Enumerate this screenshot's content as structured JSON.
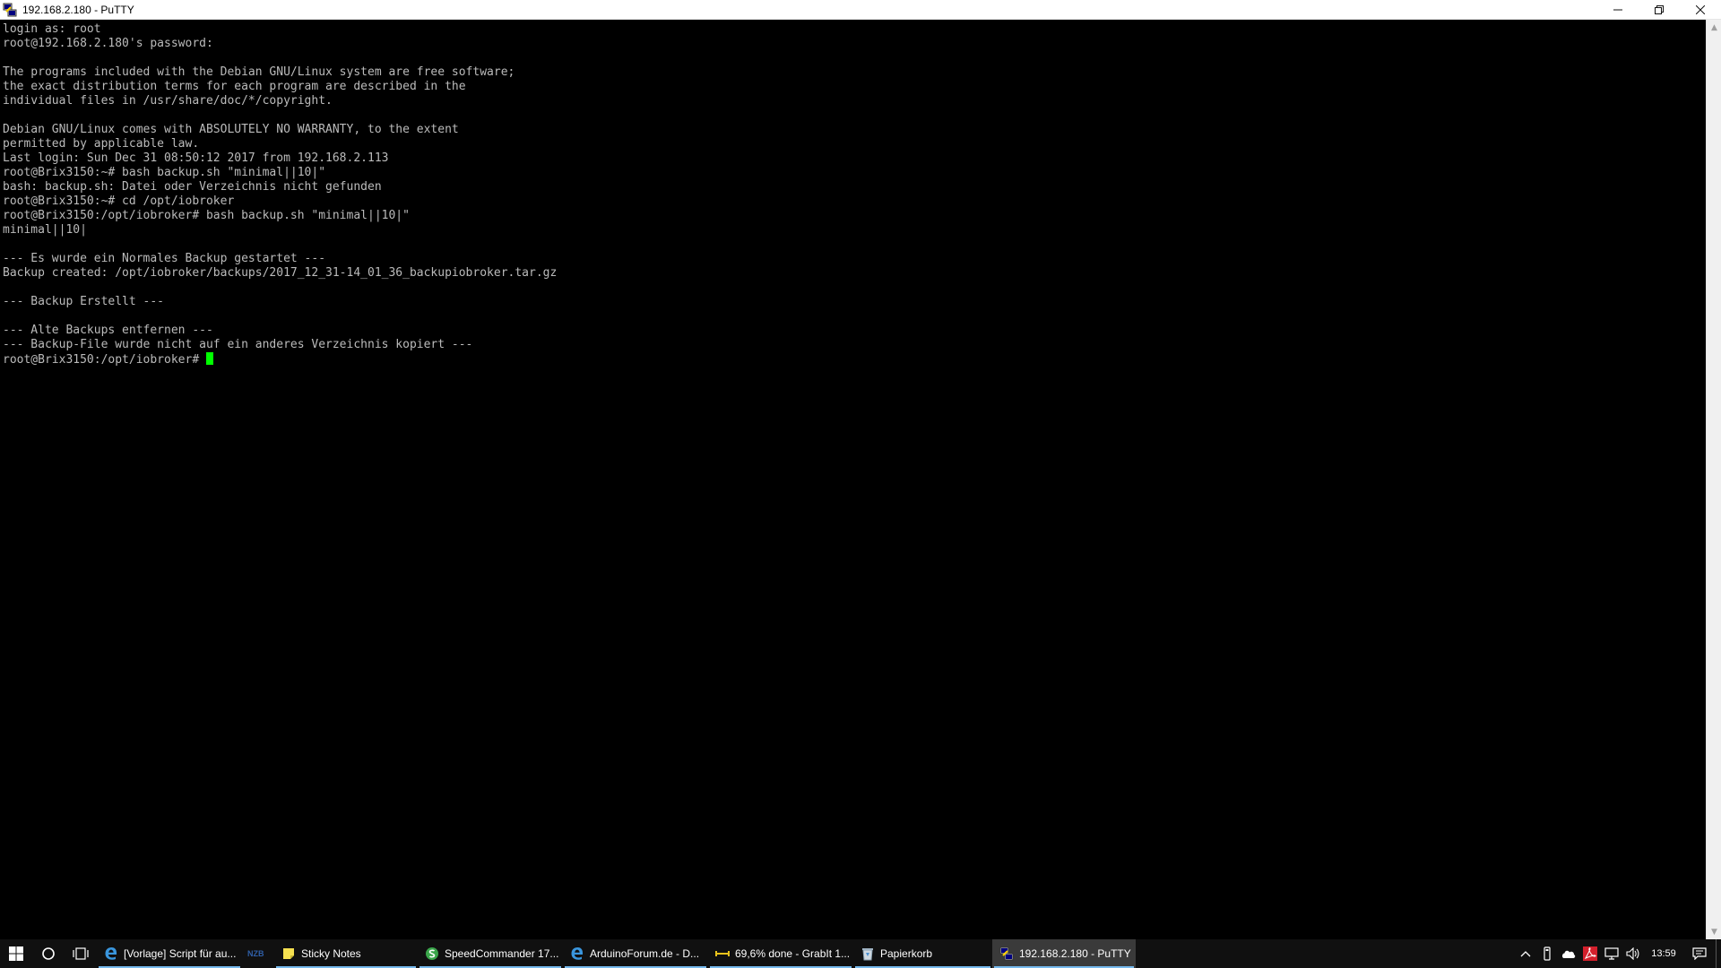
{
  "window": {
    "title": "192.168.2.180 - PuTTY",
    "icon": "putty-icon"
  },
  "terminal": {
    "lines": [
      "login as: root",
      "root@192.168.2.180's password:",
      "",
      "The programs included with the Debian GNU/Linux system are free software;",
      "the exact distribution terms for each program are described in the",
      "individual files in /usr/share/doc/*/copyright.",
      "",
      "Debian GNU/Linux comes with ABSOLUTELY NO WARRANTY, to the extent",
      "permitted by applicable law.",
      "Last login: Sun Dec 31 08:50:12 2017 from 192.168.2.113",
      "root@Brix3150:~# bash backup.sh \"minimal||10|\"",
      "bash: backup.sh: Datei oder Verzeichnis nicht gefunden",
      "root@Brix3150:~# cd /opt/iobroker",
      "root@Brix3150:/opt/iobroker# bash backup.sh \"minimal||10|\"",
      "minimal||10|",
      "",
      "--- Es wurde ein Normales Backup gestartet ---",
      "Backup created: /opt/iobroker/backups/2017_12_31-14_01_36_backupiobroker.tar.gz",
      "",
      "--- Backup Erstellt ---",
      "",
      "--- Alte Backups entfernen ---",
      "--- Backup-File wurde nicht auf ein anderes Verzeichnis kopiert ---"
    ],
    "prompt": "root@Brix3150:/opt/iobroker#",
    "text_color": "#bbbbbb",
    "cursor_color": "#00ff00"
  },
  "taskbar": {
    "items": [
      {
        "label": "[Vorlage] Script für au...",
        "icon": "edge-icon",
        "running": true,
        "active": false
      },
      {
        "label": "",
        "icon": "nzb-icon",
        "running": false,
        "active": false
      },
      {
        "label": "Sticky Notes",
        "icon": "sticky-notes-icon",
        "running": true,
        "active": false
      },
      {
        "label": "SpeedCommander 17...",
        "icon": "speedcommander-icon",
        "running": true,
        "active": false
      },
      {
        "label": "ArduinoForum.de - D...",
        "icon": "edge-icon",
        "running": true,
        "active": false
      },
      {
        "label": "69,6% done - GrabIt 1...",
        "icon": "grabit-icon",
        "running": true,
        "active": false
      },
      {
        "label": "Papierkorb",
        "icon": "recycle-bin-icon",
        "running": true,
        "active": false
      },
      {
        "label": "192.168.2.180 - PuTTY",
        "icon": "putty-icon",
        "running": true,
        "active": true
      }
    ],
    "nzb_text": "NZB",
    "clock": "13:59"
  }
}
